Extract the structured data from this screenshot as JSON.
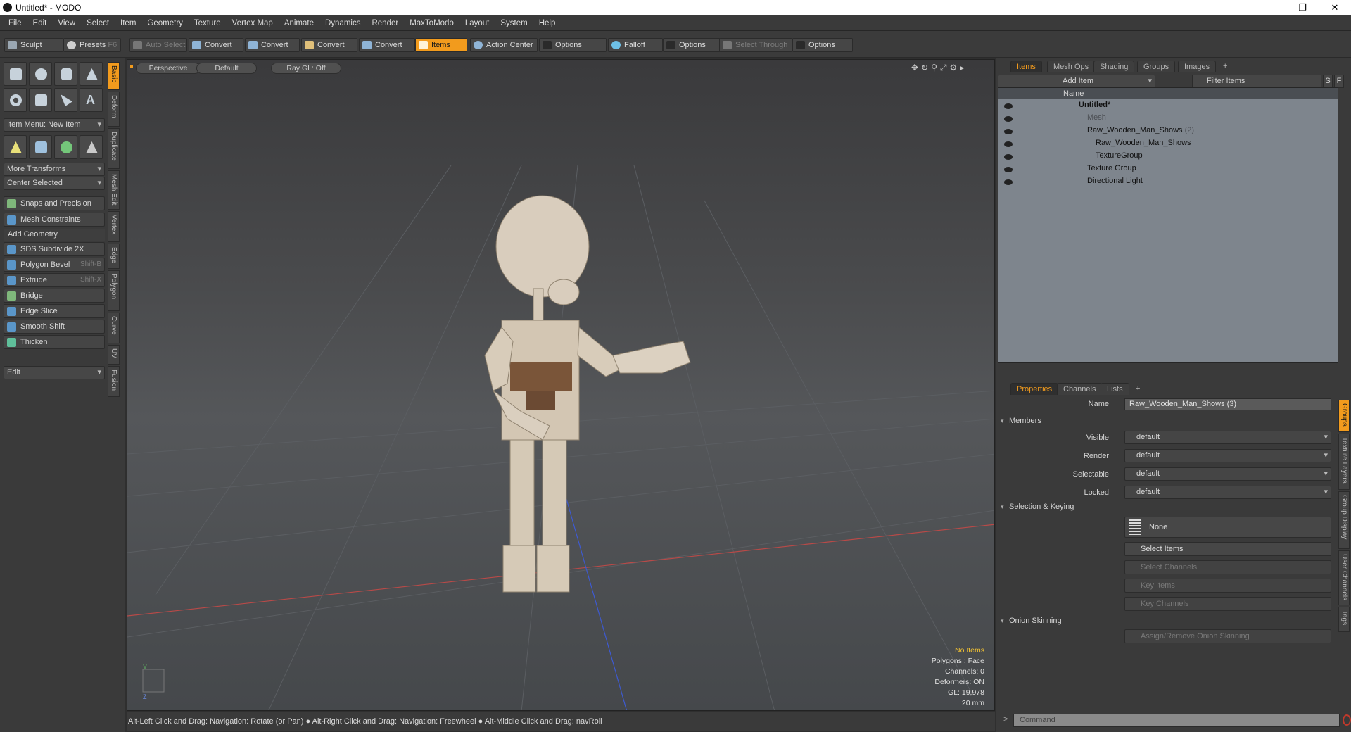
{
  "window": {
    "title": "Untitled* - MODO"
  },
  "menu": [
    "File",
    "Edit",
    "View",
    "Select",
    "Item",
    "Geometry",
    "Texture",
    "Vertex Map",
    "Animate",
    "Dynamics",
    "Render",
    "MaxToModo",
    "Layout",
    "System",
    "Help"
  ],
  "toolbar": {
    "sculpt": "Sculpt",
    "presets": "Presets",
    "presets_shortcut": "F6",
    "auto_select": "Auto Select",
    "convert_1": "Convert",
    "convert_2": "Convert",
    "convert_3": "Convert",
    "convert_4": "Convert",
    "items": "Items",
    "action_center": "Action Center",
    "options_1": "Options",
    "falloff": "Falloff",
    "options_2": "Options",
    "select_through": "Select Through",
    "options_3": "Options"
  },
  "left": {
    "item_menu": "Item Menu: New Item",
    "more_transforms": "More Transforms",
    "center_selected": "Center Selected",
    "snaps": "Snaps and Precision",
    "mesh_constraints": "Mesh Constraints",
    "add_geometry": "Add Geometry",
    "tools": [
      {
        "label": "SDS Subdivide 2X",
        "shortcut": ""
      },
      {
        "label": "Polygon Bevel",
        "shortcut": "Shift-B"
      },
      {
        "label": "Extrude",
        "shortcut": "Shift-X"
      },
      {
        "label": "Bridge",
        "shortcut": ""
      },
      {
        "label": "Edge Slice",
        "shortcut": ""
      },
      {
        "label": "Smooth Shift",
        "shortcut": ""
      },
      {
        "label": "Thicken",
        "shortcut": ""
      }
    ],
    "edit_dropdown": "Edit",
    "vtabs": [
      "Basic",
      "Deform",
      "Duplicate",
      "Mesh Edit",
      "Vertex",
      "Edge",
      "Polygon",
      "Curve",
      "UV",
      "Fusion"
    ]
  },
  "viewport": {
    "view": "Perspective",
    "shading": "Default",
    "raygl": "Ray GL: Off",
    "info": [
      "No Items",
      "Polygons : Face",
      "Channels: 0",
      "Deformers: ON",
      "GL: 19,978",
      "20 mm"
    ],
    "axis_y": "Y",
    "axis_z": "Z"
  },
  "status": {
    "hint_1": "Alt-Left Click and Drag: Navigation: Rotate (or Pan)",
    "hint_2": "Alt-Right Click and Drag: Navigation: Freewheel",
    "hint_3": "Alt-Middle Click and Drag: navRoll"
  },
  "right": {
    "tabs": [
      "Items",
      "Mesh Ops",
      "Shading",
      "Groups",
      "Images",
      "+"
    ],
    "add_item": "Add Item",
    "filter_items": "Filter Items",
    "filter_s": "S",
    "filter_f": "F",
    "column_name": "Name",
    "tree": [
      {
        "label": "Untitled*",
        "count": ""
      },
      {
        "label": "Mesh",
        "count": ""
      },
      {
        "label": "Raw_Wooden_Man_Shows",
        "count": "(2)"
      },
      {
        "label": "Raw_Wooden_Man_Shows",
        "count": ""
      },
      {
        "label": "TextureGroup",
        "count": ""
      },
      {
        "label": "Texture Group",
        "count": ""
      },
      {
        "label": "Directional Light",
        "count": ""
      }
    ],
    "prop_tabs": [
      "Properties",
      "Channels",
      "Lists",
      "+"
    ],
    "name_label": "Name",
    "name_value": "Raw_Wooden_Man_Shows (3)",
    "members": "Members",
    "visible_label": "Visible",
    "visible_value": "default",
    "render_label": "Render",
    "render_value": "default",
    "selectable_label": "Selectable",
    "selectable_value": "default",
    "locked_label": "Locked",
    "locked_value": "default",
    "selection_keying": "Selection & Keying",
    "none": "None",
    "select_items": "Select Items",
    "select_channels": "Select Channels",
    "key_items": "Key Items",
    "key_channels": "Key Channels",
    "onion": "Onion Skinning",
    "assign_onion": "Assign/Remove Onion Skinning",
    "side_tabs": [
      "Groups",
      "Texture Layers",
      "Group Display",
      "User Channels",
      "Tags"
    ],
    "command_placeholder": "Command"
  },
  "colors": {
    "accent": "#f29b1d",
    "bg": "#3a3a3a",
    "list_bg": "#7e858d"
  }
}
